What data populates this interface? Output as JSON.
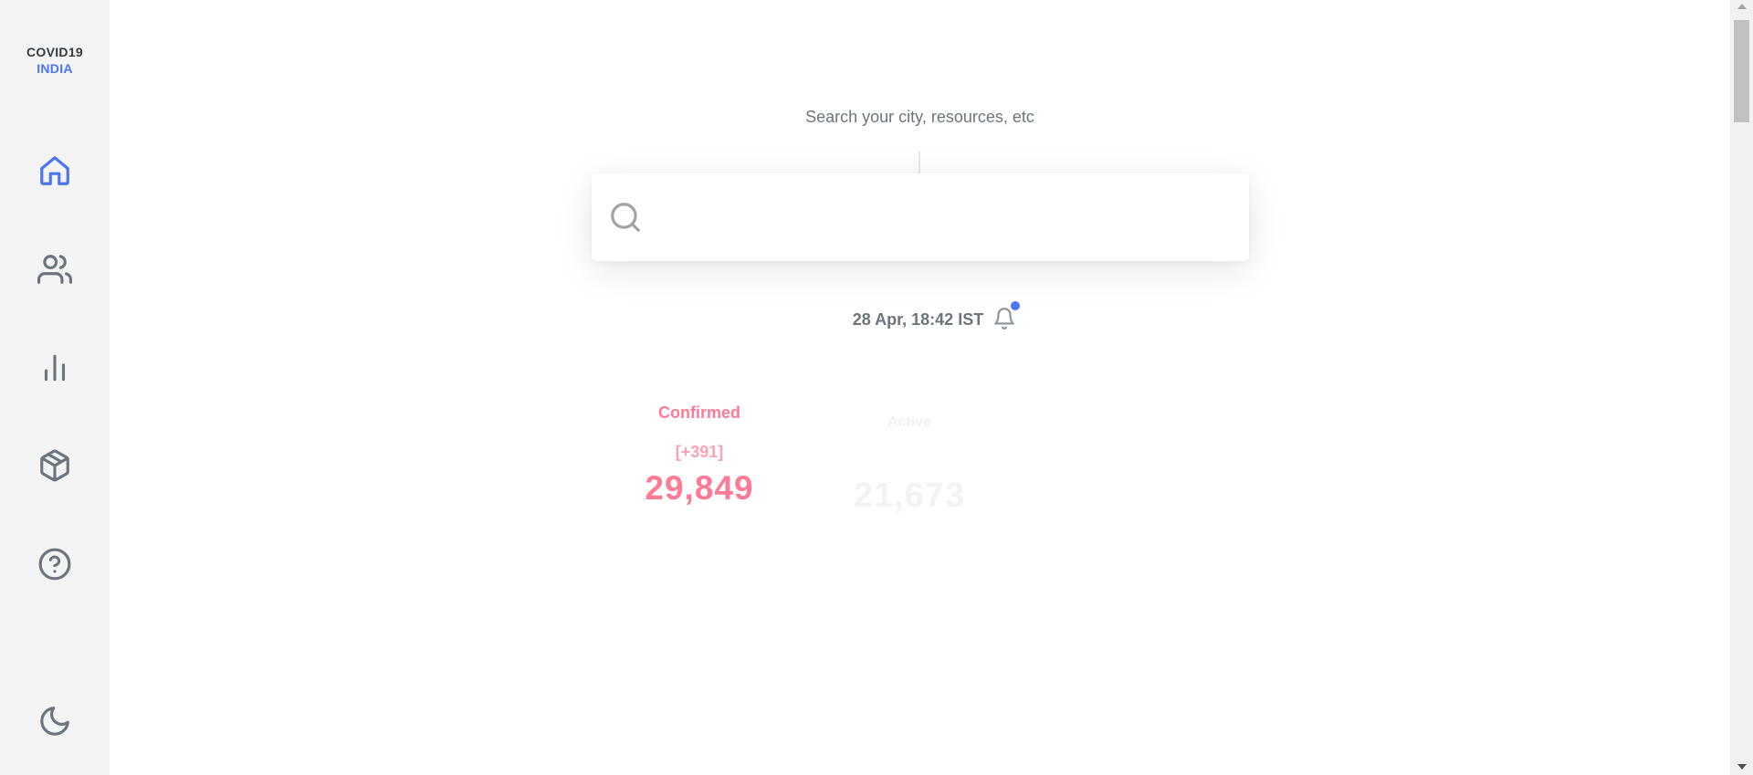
{
  "logo": {
    "line1": "COVID19",
    "line2": "INDIA"
  },
  "sidebar": {
    "items": [
      {
        "name": "home",
        "icon": "home-icon",
        "active": true
      },
      {
        "name": "users",
        "icon": "users-icon",
        "active": false
      },
      {
        "name": "charts",
        "icon": "bar-chart-icon",
        "active": false
      },
      {
        "name": "resources",
        "icon": "package-icon",
        "active": false
      },
      {
        "name": "help",
        "icon": "help-circle-icon",
        "active": false
      }
    ],
    "theme_toggle": {
      "icon": "moon-icon"
    }
  },
  "search": {
    "label": "Search your city, resources, etc",
    "value": "",
    "placeholder": ""
  },
  "update": {
    "timestamp": "28 Apr, 18:42 IST",
    "has_notification": true
  },
  "stats": {
    "confirmed": {
      "label": "Confirmed",
      "delta": "[+391]",
      "value": "29,849"
    },
    "active": {
      "label": "Active",
      "value": "21,673"
    }
  },
  "colors": {
    "accent": "#4c75f2",
    "confirmed": "#ff7a95",
    "icon": "#6c757d",
    "sidebar_bg": "#f4f4f5"
  }
}
